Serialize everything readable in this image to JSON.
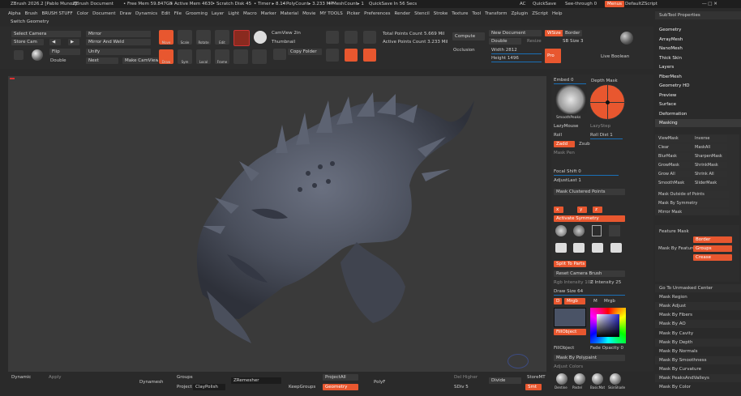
{
  "titlebar": {
    "title": "ZBrush 2026.2 [Pablo Munoz]",
    "doc": "ZBrush Document",
    "free_mem": "• Free Mem 59.847GB",
    "active_mem": "• Active Mem 4630",
    "scratch": "• Scratch Disk 45",
    "timer": "• Timer ▸ 8.14",
    "polycount": "• PolyCount▸ 3.233 MP",
    "meshcount": "• MeshCount▸ 1",
    "quicksave_timer": "QuickSave In 56 Secs",
    "ac": "AC",
    "quicksave": "QuickSave",
    "seethrough": "See-through 0",
    "menus_btn": "Menus",
    "zscript": "DefaultZScript"
  },
  "menubar": {
    "items": [
      "Alpha",
      "Brush",
      "BRUSH STUFF",
      "Color",
      "Document",
      "Draw",
      "Dynamics",
      "Edit",
      "File",
      "Grooming",
      "Layer",
      "Light",
      "Macro",
      "Marker",
      "Material",
      "Movie",
      "MY TOOLS",
      "Picker",
      "Preferences",
      "Render",
      "Stencil",
      "Stroke",
      "Texture",
      "Tool",
      "Transform",
      "Zplugin",
      "ZScript",
      "Help"
    ]
  },
  "subbar": {
    "label": "Switch Geometry"
  },
  "shelf": {
    "select_camera": "Select Camera",
    "store_cam": "Store Cam",
    "mirror": "Mirror",
    "mirror_weld": "Mirror And Weld",
    "flip": "Flip",
    "double": "Double",
    "unify": "Unify",
    "next": "Next",
    "make_camview": "Make CamView",
    "camview": "CamView 2in",
    "thumbnail": "Thumbnail",
    "copy_folder": "Copy Folder",
    "tools": [
      "Move",
      "Scale",
      "Rotate",
      "Edit",
      "Draw",
      "Sym",
      "Local",
      "Frame"
    ],
    "total_points": "Total Points Count 5.669 Mil",
    "active_points": "Active Points Count 3.233 Mil",
    "compute": "Compute",
    "occlusion": "Occlusion",
    "new_document": "New Document",
    "double_btn": "Double",
    "resize": "Resize",
    "width_label": "Width 2812",
    "height_label": "Height 1496",
    "wsize": "WSize",
    "border": "Border",
    "size": "SB Size 3",
    "pro": "Pro",
    "live_boolean": "Live Boolean"
  },
  "tool_panel": {
    "smooth_label": "SmoothPeaks",
    "depth_mask": "Depth Mask",
    "embed": "Embed 0",
    "lazymouse": "LazyMouse",
    "lazystep": "LazyStep",
    "roll": "Roll",
    "roll_dist": "Roll Dist 1",
    "zadd": "Zadd",
    "zsub": "Zsub",
    "mask_pen": "Mask Pen",
    "focal_shift": "Focal Shift 0",
    "adjust_last": "AdjustLast 1",
    "mask_clustered": "Mask Clustered Points",
    "activate_symmetry": "Activate Symmetry",
    "split_to_parts": "Split To Parts",
    "reset_camera": "Reset Camera Brush",
    "rgb_intensity": "Rgb Intensity 100",
    "z_intensity": "Z Intensity 25",
    "draw_size": "Draw Size 64",
    "dynamic": "Dynamic",
    "mrgb": "Mrgb",
    "rgb": "Rgb",
    "m": "M",
    "fill_object": "FillObject",
    "mask_by_polypaint": "Mask By Polypaint",
    "fade_opacity": "Fade Opacity 0",
    "xyz": "XYZ",
    "brush_labels": [
      "Mask",
      "Sel",
      "Lasso",
      "SelRect",
      "ClipCur"
    ],
    "brush_labels2": [
      "SculptrisProd",
      "SliceCurve",
      "ClipCur"
    ],
    "adjust_colors": "Adjust Colors"
  },
  "right_panel": {
    "title": "SubTool Properties",
    "items": [
      "Geometry",
      "ArrayMesh",
      "NanoMesh",
      "Thick Skin",
      "Layers",
      "FiberMesh",
      "Geometry HD",
      "Preview",
      "Surface",
      "Deformation",
      "Masking"
    ],
    "masking_btns": [
      "ViewMask",
      "Inverse",
      "Clear",
      "MaskAll",
      "BlurMask",
      "SharpenMask",
      "GrowMask",
      "ShrinkMask",
      "Grow All",
      "Shrink All",
      "SmoothMask",
      "SliderMask"
    ],
    "mask_items": [
      "Mask Outside of Points",
      "Mask By Symmetry",
      "Mirror Mask",
      "Mask By Feature",
      "Border",
      "Groups",
      "Crease",
      "Mask By Smoothness",
      "Mask By Cavity",
      "Mask By Occlusion",
      "Mask By Depth",
      "Mask By Normals",
      "Mask By Color",
      "Mask By AO",
      "Mask Ambient Occlusion",
      "Mask By Curvature",
      "Mask Peaks And Valleys",
      "Mask By Color"
    ],
    "list": [
      "Feature Mask",
      "Go To Unmasked Center",
      "Mask Region",
      "Mask Adjust",
      "Mask By Fibers",
      "Mask By AO",
      "Mask By Cavity",
      "Mask By Depth",
      "Mask By Normals",
      "Mask By Smoothness",
      "Mask By Curvature",
      "Mask PeaksAndValleys",
      "Mask By Color"
    ]
  },
  "bottom": {
    "dynamic": "Dynamic",
    "apply": "Apply",
    "dynamesh": "Dynamesh",
    "groups": "Groups",
    "project": "Project",
    "clay_polish": "ClayPolish",
    "zremesher": "ZRemesher",
    "keepgroups": "KeepGroups",
    "project_all": "ProjectAll",
    "geometry": "Geometry",
    "pixol": "Pixol",
    "polish": "Polish",
    "resolution": "Resolution 128",
    "del_higher": "Del Higher",
    "sdiv": "SDiv 5",
    "divide": "Divide",
    "smt": "Smt",
    "suv": "Suv",
    "store_mt": "StoreMT",
    "poly_f": "PolyF",
    "materials": [
      "Dentine",
      "Pastel",
      "BasicMat",
      "SkinShade"
    ]
  },
  "colors": {
    "accent": "#e8572f",
    "slider": "#1a6fb7",
    "model": "#4e5361"
  }
}
